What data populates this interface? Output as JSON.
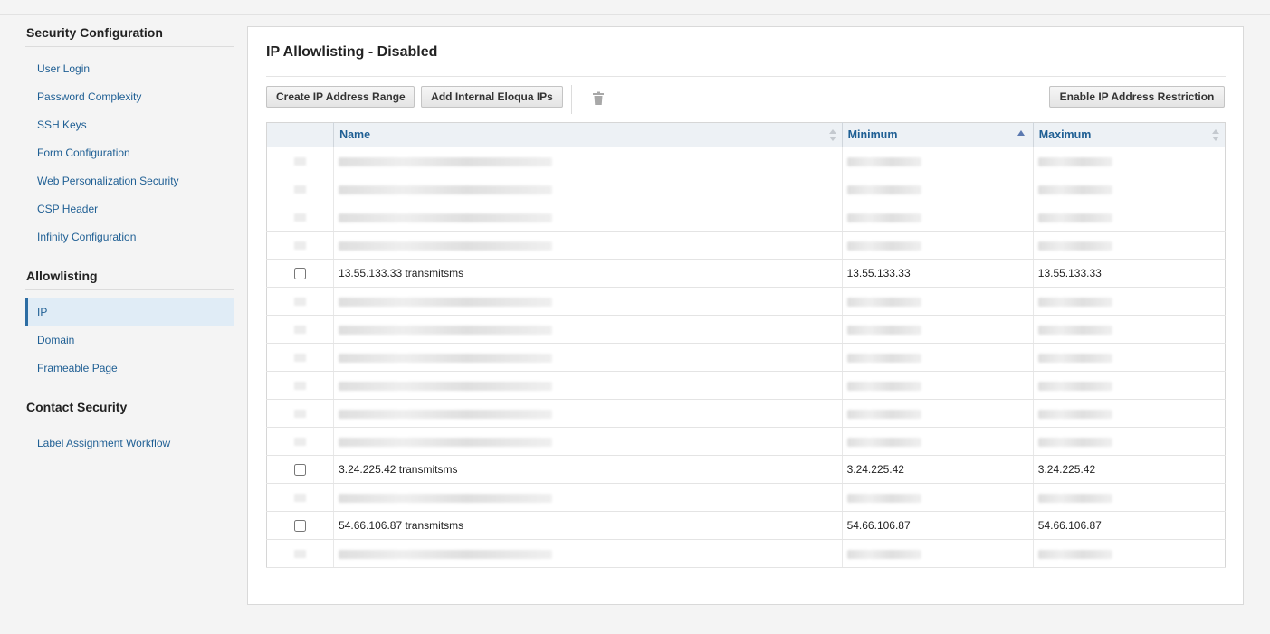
{
  "sidebar": {
    "sections": [
      {
        "title": "Security Configuration",
        "items": [
          "User Login",
          "Password Complexity",
          "SSH Keys",
          "Form Configuration",
          "Web Personalization Security",
          "CSP Header",
          "Infinity Configuration"
        ]
      },
      {
        "title": "Allowlisting",
        "items": [
          "IP",
          "Domain",
          "Frameable Page"
        ],
        "active": "IP"
      },
      {
        "title": "Contact Security",
        "items": [
          "Label Assignment Workflow"
        ]
      }
    ]
  },
  "main": {
    "title": "IP Allowlisting - Disabled",
    "toolbar": {
      "create_label": "Create IP Address Range",
      "eloqua_label": "Add Internal Eloqua IPs",
      "delete_icon": "trash-icon",
      "enable_label": "Enable IP Address Restriction"
    },
    "table": {
      "columns": {
        "name": "Name",
        "minimum": "Minimum",
        "maximum": "Maximum"
      },
      "sorted_column": "Minimum",
      "sort_direction": "ascending",
      "rows": [
        {
          "redacted": true
        },
        {
          "redacted": true
        },
        {
          "redacted": true
        },
        {
          "redacted": true
        },
        {
          "redacted": false,
          "name": "13.55.133.33 transmitsms",
          "minimum": "13.55.133.33",
          "maximum": "13.55.133.33"
        },
        {
          "redacted": true
        },
        {
          "redacted": true
        },
        {
          "redacted": true
        },
        {
          "redacted": true
        },
        {
          "redacted": true
        },
        {
          "redacted": true
        },
        {
          "redacted": false,
          "name": "3.24.225.42 transmitsms",
          "minimum": "3.24.225.42",
          "maximum": "3.24.225.42"
        },
        {
          "redacted": true
        },
        {
          "redacted": false,
          "name": "54.66.106.87 transmitsms",
          "minimum": "54.66.106.87",
          "maximum": "54.66.106.87"
        },
        {
          "redacted": true
        }
      ]
    }
  },
  "colors": {
    "link": "#1f5f94",
    "active_bg": "#e0ecf6",
    "header_bg": "#edf1f5"
  }
}
